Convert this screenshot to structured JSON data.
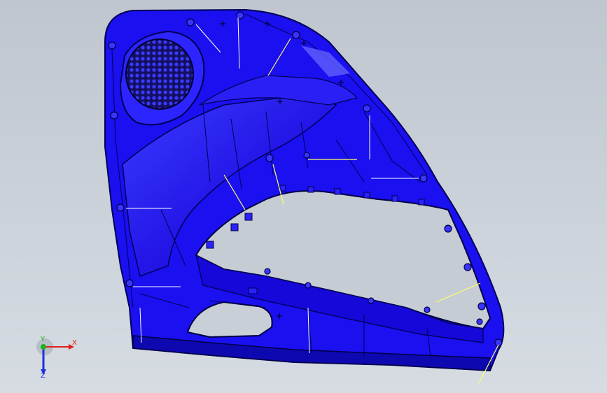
{
  "viewport": {
    "background_top": "#bfc6cf",
    "background_bottom": "#d6dce2"
  },
  "model": {
    "name": "door-trim-panel",
    "face_color": "#1a10f0",
    "edge_color": "#000055",
    "highlight_color": "#5a5cff",
    "annotation_line_color": "#ffff66",
    "icon": "speaker-grille-icon"
  },
  "triad": {
    "x_label": "X",
    "y_label": "Y",
    "z_label": "Z",
    "x_color": "#e02020",
    "y_color": "#20b020",
    "z_color": "#2030e0"
  }
}
